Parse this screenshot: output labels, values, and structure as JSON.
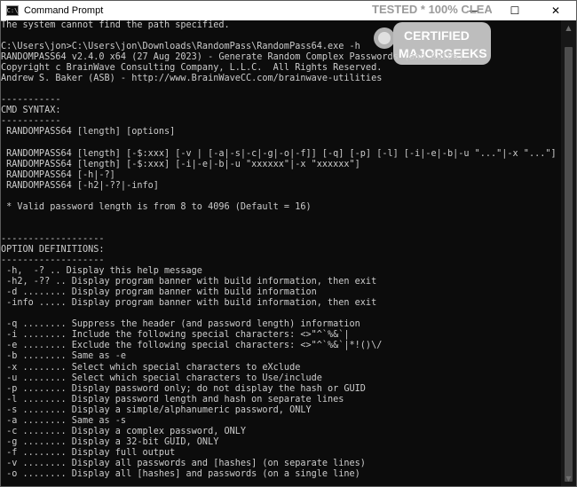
{
  "window": {
    "title": "Command Prompt",
    "app_icon_glyph": "C:\\",
    "minimize_glyph": "—",
    "maximize_glyph": "☐",
    "close_glyph": "✕"
  },
  "watermark": {
    "top_text": "TESTED * 100% CLEAN",
    "brand": "MAJORGEEKS",
    "badge": "CERTIFIED",
    "color": "#9a9a9a"
  },
  "console": {
    "text_color": "#cccccc",
    "background": "#0c0c0c",
    "lines": [
      "The system cannot find the path specified.",
      "",
      "C:\\Users\\jon>C:\\Users\\jon\\Downloads\\RandomPass\\RandomPass64.exe -h",
      "RANDOMPASS64 v2.4.0 x64 (27 Aug 2023) - Generate Random Complex Passwords (and GUIDs)",
      "Copyright c BrainWave Consulting Company, L.L.C.  All Rights Reserved.",
      "Andrew S. Baker (ASB) - http://www.BrainWaveCC.com/brainwave-utilities",
      "",
      "-----------",
      "CMD SYNTAX:",
      "-----------",
      " RANDOMPASS64 [length] [options]",
      "",
      " RANDOMPASS64 [length] [-$:xxx] [-v | [-a|-s|-c|-g|-o|-f]] [-q] [-p] [-l] [-i|-e|-b|-u \"...\"|-x \"...\"]",
      " RANDOMPASS64 [length] [-$:xxx] [-i|-e|-b|-u \"xxxxxx\"|-x \"xxxxxx\"]",
      " RANDOMPASS64 [-h|-?]",
      " RANDOMPASS64 [-h2|-??|-info]",
      "",
      " * Valid password length is from 8 to 4096 (Default = 16)",
      "",
      "",
      "-------------------",
      "OPTION DEFINITIONS:",
      "-------------------",
      " -h,  -? .. Display this help message",
      " -h2, -?? .. Display program banner with build information, then exit",
      " -d ........ Display program banner with build information",
      " -info ..... Display program banner with build information, then exit",
      "",
      " -q ........ Suppress the header (and password length) information",
      " -i ........ Include the following special characters: <>\"^`%&`|",
      " -e ........ Exclude the following special characters: <>\"^`%&`|*!()\\/",
      " -b ........ Same as -e",
      " -x ........ Select which special characters to eXclude",
      " -u ........ Select which special characters to Use/include",
      " -p ........ Display password only; do not display the hash or GUID",
      " -l ........ Display password length and hash on separate lines",
      " -s ........ Display a simple/alphanumeric password, ONLY",
      " -a ........ Same as -s",
      " -c ........ Display a complex password, ONLY",
      " -g ........ Display a 32-bit GUID, ONLY",
      " -f ........ Display full output",
      " -v ........ Display all passwords and [hashes] (on separate lines)",
      " -o ........ Display all [hashes] and passwords (on a single line)"
    ]
  }
}
